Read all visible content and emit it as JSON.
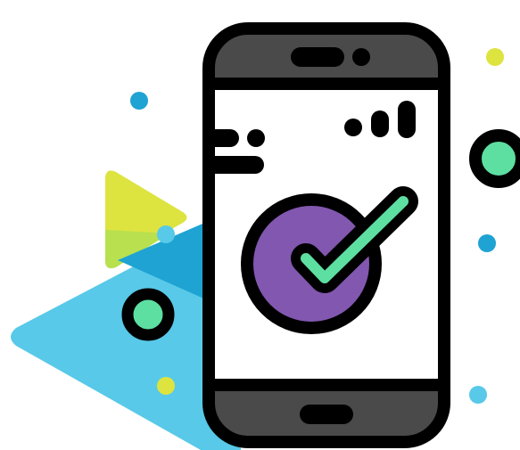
{
  "illustration": {
    "subject": "smartphone-with-checkmark",
    "icons": {
      "phone": "smartphone-icon",
      "check": "check-circle-icon",
      "signal": "signal-bars-icon",
      "text_lines": "text-lines-icon"
    },
    "colors": {
      "outline": "#000000",
      "phone_body": "#4a4a4a",
      "screen": "#ffffff",
      "check_circle": "#8257b0",
      "check_mark": "#5ddfa2",
      "triangle_light_blue": "#58c9e8",
      "triangle_mid_blue": "#1ea3d3",
      "triangle_yellow": "#dde43f",
      "triangle_green": "#b8e04f",
      "dot_yellow": "#dde43f",
      "dot_blue": "#1ea3d3",
      "dot_light_blue": "#58c9e8",
      "ring_fill": "#5ddfa2"
    }
  }
}
